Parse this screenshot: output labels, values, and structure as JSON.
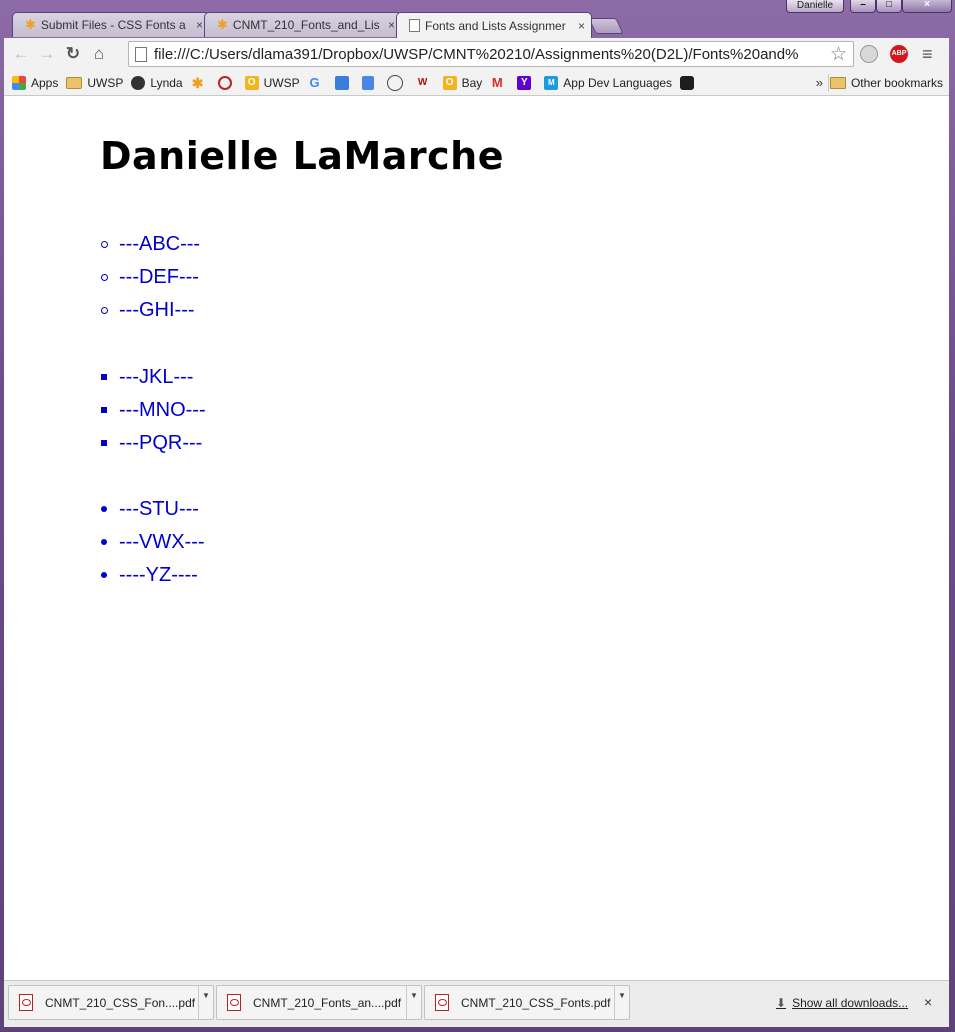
{
  "window": {
    "profile_name": "Danielle",
    "controls": [
      "–",
      "□",
      "×"
    ]
  },
  "tabs": [
    {
      "title": "Submit Files - CSS Fonts a",
      "close": "×",
      "active": false
    },
    {
      "title": "CNMT_210_Fonts_and_Lis",
      "close": "×",
      "active": false
    },
    {
      "title": "Fonts and Lists Assignmer",
      "close": "×",
      "active": true
    }
  ],
  "toolbar": {
    "back": "←",
    "forward": "→",
    "reload": "↻",
    "home": "⌂",
    "url": "file:///C:/Users/dlama391/Dropbox/UWSP/CMNT%20210/Assignments%20(D2L)/Fonts%20and%",
    "star": "☆",
    "abp_label": "ABP",
    "menu": "≡"
  },
  "bookmarks": {
    "items": [
      {
        "label": "Apps",
        "icon": "apps-grid-icon"
      },
      {
        "label": "UWSP",
        "icon": "folder-icon"
      },
      {
        "label": "Lynda",
        "icon": "lynda-icon"
      },
      {
        "label": "",
        "icon": "d2l-star-icon"
      },
      {
        "label": "",
        "icon": "circle-badge-icon"
      },
      {
        "label": "UWSP",
        "icon": "outlook-icon"
      },
      {
        "label": "",
        "icon": "google-icon"
      },
      {
        "label": "",
        "icon": "puzzle-icon"
      },
      {
        "label": "",
        "icon": "docs-icon"
      },
      {
        "label": "",
        "icon": "owl-icon"
      },
      {
        "label": "",
        "icon": "wa-icon"
      },
      {
        "label": "Bay",
        "icon": "outlook-icon"
      },
      {
        "label": "",
        "icon": "gmail-icon"
      },
      {
        "label": "",
        "icon": "yahoo-icon"
      },
      {
        "label": "App Dev Languages",
        "icon": "m-icon"
      },
      {
        "label": "",
        "icon": "green-dot-icon"
      }
    ],
    "more": "»",
    "other": "Other bookmarks"
  },
  "page": {
    "heading": "Danielle LaMarche",
    "list_circle": [
      "---ABC---",
      "---DEF---",
      "---GHI---"
    ],
    "list_square": [
      "---JKL---",
      "---MNO---",
      "---PQR---"
    ],
    "list_disc": [
      "---STU---",
      "---VWX---",
      "----YZ----"
    ],
    "text_color": "#0000cc"
  },
  "downloads": {
    "items": [
      {
        "name": "CNMT_210_CSS_Fon....pdf"
      },
      {
        "name": "CNMT_210_Fonts_an....pdf"
      },
      {
        "name": "CNMT_210_CSS_Fonts.pdf"
      }
    ],
    "show_all": "Show all downloads...",
    "close": "×"
  }
}
